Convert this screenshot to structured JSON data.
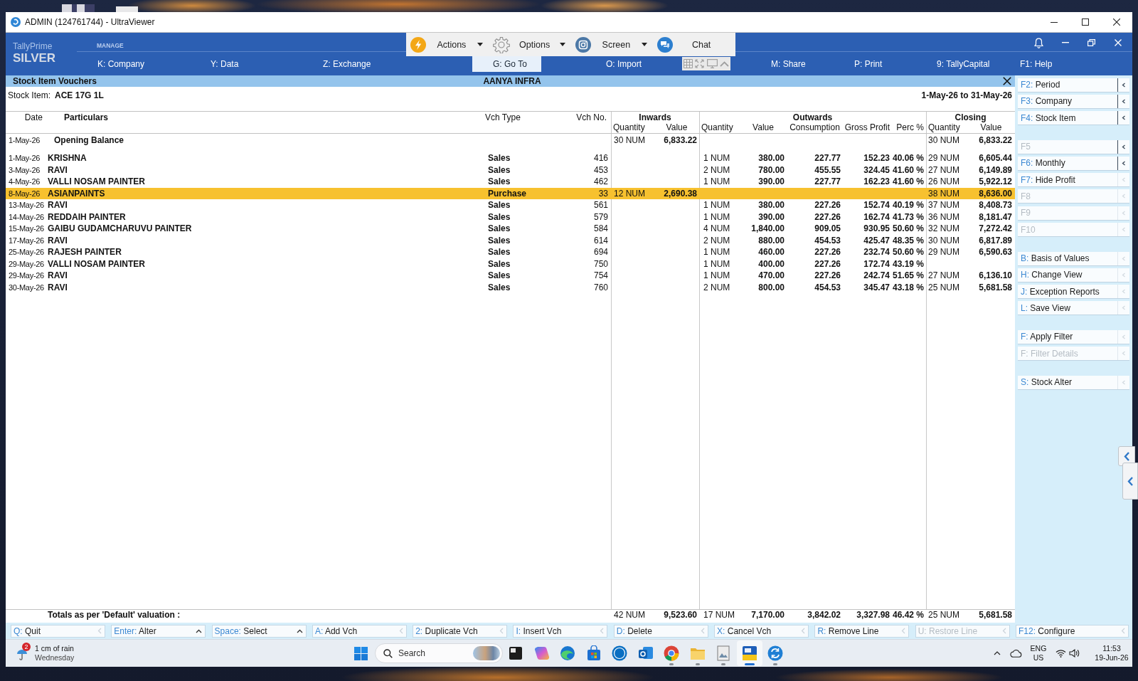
{
  "window": {
    "title": "ADMIN (124761744) - UltraViewer"
  },
  "remote_toolbar": {
    "buttons": [
      {
        "kind": "actions",
        "label": "Actions",
        "dropdown": true
      },
      {
        "kind": "options",
        "label": "Options",
        "dropdown": true
      },
      {
        "kind": "screen",
        "label": "Screen",
        "dropdown": true
      },
      {
        "kind": "chat",
        "label": "Chat",
        "dropdown": false
      }
    ]
  },
  "app_header": {
    "product": "TallyPrime",
    "edition": "SILVER",
    "section": "MANAGE",
    "menu": [
      {
        "key": "K:",
        "label": "Company",
        "selected": false
      },
      {
        "key": "Y:",
        "label": "Data",
        "selected": false
      },
      {
        "key": "Z:",
        "label": "Exchange",
        "selected": false
      },
      {
        "key": "G:",
        "label": "Go To",
        "selected": true
      },
      {
        "key": "O:",
        "label": "Import",
        "selected": false
      },
      {
        "key": "M:",
        "label": "Share",
        "selected": false
      },
      {
        "key": "P:",
        "label": "Print",
        "selected": false
      },
      {
        "key": "9:",
        "label": "TallyCapital",
        "selected": false
      },
      {
        "key": "F1:",
        "label": "Help",
        "selected": false
      }
    ]
  },
  "report": {
    "title": "Stock Item Vouchers",
    "company": "AANYA INFRA",
    "item_label": "Stock Item:",
    "item": "ACE 17G 1L",
    "period": "1-May-26 to 31-May-26",
    "columns": [
      "Date",
      "Particulars",
      "Vch Type",
      "Vch No."
    ],
    "column_groups": [
      {
        "label": "Inwards",
        "columns": [
          "Quantity",
          "Value"
        ]
      },
      {
        "label": "Outwards",
        "columns": [
          "Quantity",
          "Value",
          "Consumption",
          "Gross Profit",
          "Perc %"
        ]
      },
      {
        "label": "Closing",
        "columns": [
          "Quantity",
          "Value"
        ]
      }
    ],
    "opening": {
      "date": "1-May-26",
      "particulars": "Opening Balance",
      "in_qty": "30 NUM",
      "in_value": "6,833.22",
      "closing_qty": "30 NUM",
      "closing_value": "6,833.22"
    },
    "rows": [
      {
        "date": "1-May-26",
        "particulars": "KRISHNA",
        "vch_type": "Sales",
        "vch_no": "416",
        "out_qty": "1 NUM",
        "out_value": "380.00",
        "consumption": "227.77",
        "gross_profit": "152.23",
        "perc": "40.06 %",
        "closing_qty": "29 NUM",
        "closing_value": "6,605.44",
        "selected": false
      },
      {
        "date": "3-May-26",
        "particulars": "RAVI",
        "vch_type": "Sales",
        "vch_no": "453",
        "out_qty": "2 NUM",
        "out_value": "780.00",
        "consumption": "455.55",
        "gross_profit": "324.45",
        "perc": "41.60 %",
        "closing_qty": "27 NUM",
        "closing_value": "6,149.89",
        "selected": false
      },
      {
        "date": "4-May-26",
        "particulars": "VALLI NOSAM PAINTER",
        "vch_type": "Sales",
        "vch_no": "462",
        "out_qty": "1 NUM",
        "out_value": "390.00",
        "consumption": "227.77",
        "gross_profit": "162.23",
        "perc": "41.60 %",
        "closing_qty": "26 NUM",
        "closing_value": "5,922.12",
        "selected": false
      },
      {
        "date": "8-May-26",
        "particulars": "ASIANPAINTS",
        "vch_type": "Purchase",
        "vch_no": "33",
        "in_qty": "12 NUM",
        "in_value": "2,690.38",
        "closing_qty": "38 NUM",
        "closing_value": "8,636.00",
        "selected": true
      },
      {
        "date": "13-May-26",
        "particulars": "RAVI",
        "vch_type": "Sales",
        "vch_no": "561",
        "out_qty": "1 NUM",
        "out_value": "380.00",
        "consumption": "227.26",
        "gross_profit": "152.74",
        "perc": "40.19 %",
        "closing_qty": "37 NUM",
        "closing_value": "8,408.73",
        "selected": false
      },
      {
        "date": "14-May-26",
        "particulars": "REDDAIH PAINTER",
        "vch_type": "Sales",
        "vch_no": "579",
        "out_qty": "1 NUM",
        "out_value": "390.00",
        "consumption": "227.26",
        "gross_profit": "162.74",
        "perc": "41.73 %",
        "closing_qty": "36 NUM",
        "closing_value": "8,181.47",
        "selected": false
      },
      {
        "date": "15-May-26",
        "particulars": "GAIBU GUDAMCHARUVU PAINTER",
        "vch_type": "Sales",
        "vch_no": "584",
        "out_qty": "4 NUM",
        "out_value": "1,840.00",
        "consumption": "909.05",
        "gross_profit": "930.95",
        "perc": "50.60 %",
        "closing_qty": "32 NUM",
        "closing_value": "7,272.42",
        "selected": false
      },
      {
        "date": "17-May-26",
        "particulars": "RAVI",
        "vch_type": "Sales",
        "vch_no": "614",
        "out_qty": "2 NUM",
        "out_value": "880.00",
        "consumption": "454.53",
        "gross_profit": "425.47",
        "perc": "48.35 %",
        "closing_qty": "30 NUM",
        "closing_value": "6,817.89",
        "selected": false
      },
      {
        "date": "25-May-26",
        "particulars": "RAJESH PAINTER",
        "vch_type": "Sales",
        "vch_no": "694",
        "out_qty": "1 NUM",
        "out_value": "460.00",
        "consumption": "227.26",
        "gross_profit": "232.74",
        "perc": "50.60 %",
        "closing_qty": "29 NUM",
        "closing_value": "6,590.63",
        "selected": false
      },
      {
        "date": "29-May-26",
        "particulars": "VALLI NOSAM PAINTER",
        "vch_type": "Sales",
        "vch_no": "750",
        "out_qty": "1 NUM",
        "out_value": "400.00",
        "consumption": "227.26",
        "gross_profit": "172.74",
        "perc": "43.19 %",
        "selected": false
      },
      {
        "date": "29-May-26",
        "particulars": "RAVI",
        "vch_type": "Sales",
        "vch_no": "754",
        "out_qty": "1 NUM",
        "out_value": "470.00",
        "consumption": "227.26",
        "gross_profit": "242.74",
        "perc": "51.65 %",
        "closing_qty": "27 NUM",
        "closing_value": "6,136.10",
        "selected": false
      },
      {
        "date": "30-May-26",
        "particulars": "RAVI",
        "vch_type": "Sales",
        "vch_no": "760",
        "out_qty": "2 NUM",
        "out_value": "800.00",
        "consumption": "454.53",
        "gross_profit": "345.47",
        "perc": "43.18 %",
        "closing_qty": "25 NUM",
        "closing_value": "5,681.58",
        "selected": false
      }
    ],
    "totals": {
      "label": "Totals as per 'Default' valuation :",
      "in_qty": "42 NUM",
      "in_value": "9,523.60",
      "out_qty": "17 NUM",
      "out_value": "7,170.00",
      "consumption": "3,842.02",
      "gross_profit": "3,327.98",
      "perc": "46.42 %",
      "closing_qty": "25 NUM",
      "closing_value": "5,681.58"
    }
  },
  "side_panel": {
    "groups": [
      {
        "items": [
          {
            "key": "F2:",
            "label": "Period",
            "disabled": false,
            "expandable": true
          },
          {
            "key": "F3:",
            "label": "Company",
            "disabled": false,
            "expandable": true
          },
          {
            "key": "F4:",
            "label": "Stock Item",
            "disabled": false,
            "expandable": true
          }
        ]
      },
      {
        "items": [
          {
            "key": "F5",
            "disabled": true,
            "expandable": true
          },
          {
            "key": "F6:",
            "label": "Monthly",
            "disabled": false,
            "expandable": true
          },
          {
            "key": "F7:",
            "label": "Hide Profit",
            "disabled": false,
            "expandable": false
          },
          {
            "key": "F8",
            "disabled": true,
            "expandable": false
          },
          {
            "key": "F9",
            "disabled": true,
            "expandable": false
          },
          {
            "key": "F10",
            "disabled": true,
            "expandable": false
          }
        ]
      },
      {
        "items": [
          {
            "key": "B:",
            "label": "Basis of Values",
            "disabled": false,
            "expandable": false
          },
          {
            "key": "H:",
            "label": "Change View",
            "disabled": false,
            "expandable": false
          },
          {
            "key": "J:",
            "label": "Exception Reports",
            "disabled": false,
            "expandable": false
          },
          {
            "key": "L:",
            "label": "Save View",
            "disabled": false,
            "expandable": false
          }
        ]
      },
      {
        "items": [
          {
            "key": "F:",
            "label": "Apply Filter",
            "disabled": false,
            "expandable": false
          },
          {
            "key": "F:",
            "label": "Filter Details",
            "disabled": true,
            "expandable": false
          }
        ]
      },
      {
        "items": [
          {
            "key": "S:",
            "label": "Stock Alter",
            "disabled": false,
            "expandable": false
          }
        ]
      }
    ]
  },
  "button_bar": {
    "buttons": [
      {
        "key": "Q:",
        "label": "Quit",
        "disabled": false,
        "expandable": false
      },
      {
        "key": "Enter:",
        "label": "Alter",
        "disabled": false,
        "expandable": true
      },
      {
        "key": "Space:",
        "label": "Select",
        "disabled": false,
        "expandable": true
      },
      {
        "key": "A:",
        "label": "Add Vch",
        "disabled": false,
        "expandable": false
      },
      {
        "key": "2:",
        "label": "Duplicate Vch",
        "disabled": false,
        "expandable": false
      },
      {
        "key": "I:",
        "label": "Insert Vch",
        "disabled": false,
        "expandable": false
      },
      {
        "key": "D:",
        "label": "Delete",
        "disabled": false,
        "expandable": false
      },
      {
        "key": "X:",
        "label": "Cancel Vch",
        "disabled": false,
        "expandable": false
      },
      {
        "key": "R:",
        "label": "Remove Line",
        "disabled": false,
        "expandable": false
      },
      {
        "key": "U:",
        "label": "Restore Line",
        "disabled": true,
        "expandable": false
      }
    ],
    "configure": {
      "key": "F12:",
      "label": "Configure",
      "disabled": false,
      "expandable": false
    }
  },
  "taskbar": {
    "weather": {
      "badge": "2",
      "condition": "1 cm of rain",
      "day": "Wednesday"
    },
    "search": {
      "placeholder": "Search"
    },
    "apps": [
      {
        "kind": "tasks",
        "running": false,
        "active": false
      },
      {
        "kind": "assistant",
        "running": false,
        "active": false
      },
      {
        "kind": "browser",
        "running": false,
        "active": false
      },
      {
        "kind": "store",
        "running": false,
        "active": false
      },
      {
        "kind": "vendor",
        "running": false,
        "active": false
      },
      {
        "kind": "mail",
        "running": false,
        "active": false
      },
      {
        "kind": "webbrowser",
        "running": true,
        "active": false
      },
      {
        "kind": "folder",
        "running": true,
        "active": false
      },
      {
        "kind": "viewer",
        "running": true,
        "active": false
      },
      {
        "kind": "ledger",
        "running": true,
        "active": true
      },
      {
        "kind": "remote",
        "running": true,
        "active": false
      }
    ],
    "tray": {
      "language": "ENG",
      "region": "US",
      "time": "11:53",
      "date": "19-Jun-26"
    }
  }
}
